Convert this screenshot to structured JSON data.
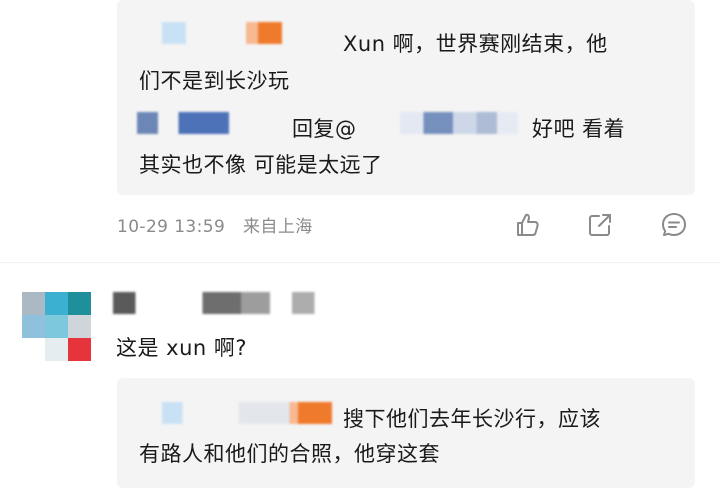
{
  "thread": {
    "reply1": {
      "line1": "Xun 啊，世界赛刚结束，他",
      "line2": "们不是到长沙玩"
    },
    "reply2": {
      "reply_word": "回复@",
      "text_after": "好吧  看着",
      "line2": "其实也不像 可能是太远了"
    },
    "meta": {
      "time": "10-29 13:59",
      "location": "来自上海"
    },
    "actions": [
      "like-icon",
      "share-icon",
      "comment-icon"
    ]
  },
  "comment": {
    "text": "这是 xun 啊?",
    "reply": {
      "line1": "搜下他们去年长沙行，应该",
      "line2": "有路人和他们的合照，他穿这套"
    }
  },
  "colors": {
    "meta_gray": "#8a8a8a",
    "reply_bg": "#f4f4f4",
    "username_blue": "#5b82c6",
    "username_orange": "#f08030"
  }
}
